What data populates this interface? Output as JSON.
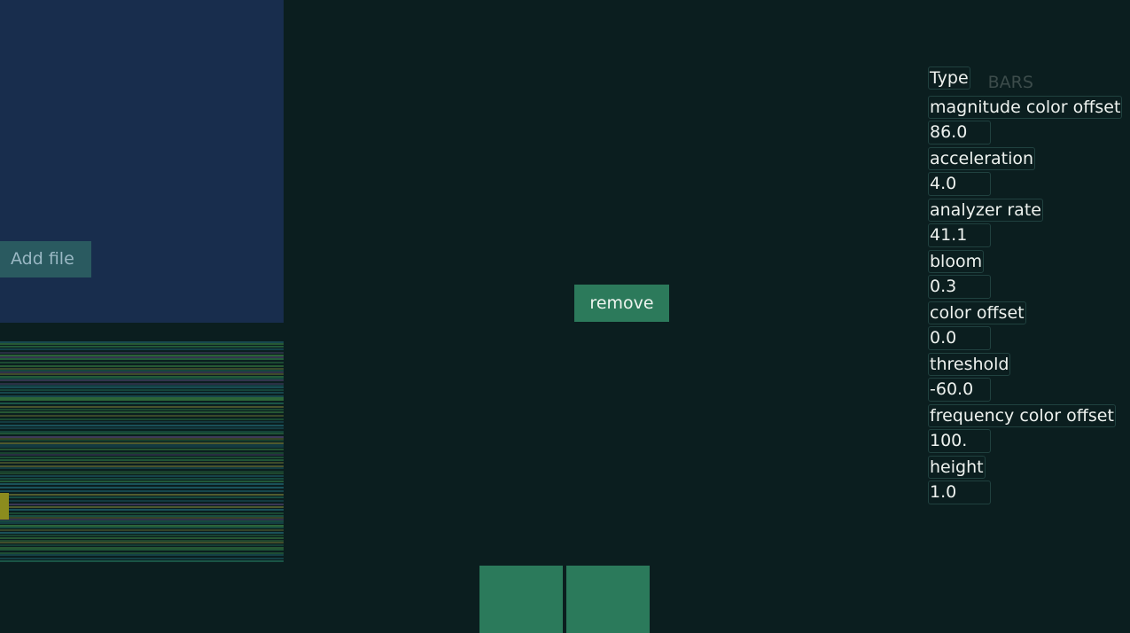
{
  "file_panel": {
    "add_file_label": "Add file"
  },
  "center": {
    "remove_label": "remove"
  },
  "settings": {
    "type_label": "Type",
    "type_value": "BARS",
    "params": [
      {
        "label": "magnitude color offset",
        "value": "86.0"
      },
      {
        "label": "acceleration",
        "value": "4.0"
      },
      {
        "label": "analyzer rate",
        "value": "41.1"
      },
      {
        "label": "bloom",
        "value": "0.3"
      },
      {
        "label": "color offset",
        "value": "0.0"
      },
      {
        "label": "threshold",
        "value": "-60.0"
      },
      {
        "label": "frequency color offset",
        "value": "100."
      },
      {
        "label": "height",
        "value": "1.0"
      }
    ]
  },
  "colors": {
    "background": "#0b1e1f",
    "file_panel": "#182d4d",
    "add_file_button": "#2a5a60",
    "accent_green": "#2c7a5b",
    "waveform_lines": [
      "#3a9a55",
      "#58c058",
      "#2a8a9a",
      "#7a5aa0",
      "#a0a040",
      "#2a9070"
    ]
  }
}
